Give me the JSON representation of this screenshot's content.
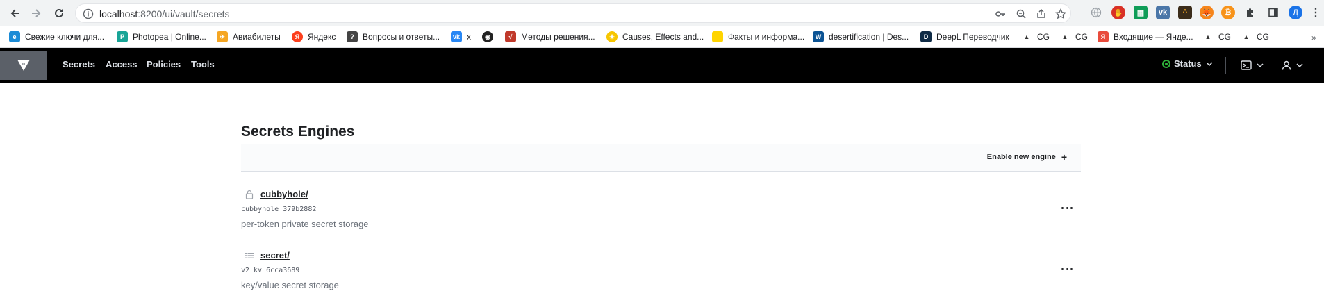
{
  "browser": {
    "url_host": "localhost",
    "url_rest": ":8200/ui/vault/secrets",
    "profile_initial": "Д",
    "bookmarks": [
      {
        "label": "Свежие ключи для...",
        "color": "#1b8bd6"
      },
      {
        "label": "Photopea | Online...",
        "color": "#18a497"
      },
      {
        "label": "Авиабилеты",
        "color": "#f5a623"
      },
      {
        "label": "Яндекс",
        "color": "#fc3f1d"
      },
      {
        "label": "Вопросы и ответы...",
        "color": "#444444"
      },
      {
        "label": "x",
        "color": "#2787f5"
      },
      {
        "label": "",
        "color": "#222222"
      },
      {
        "label": "Методы решения...",
        "color": "#c0392b"
      },
      {
        "label": "Causes, Effects and...",
        "color": "#f7c600"
      },
      {
        "label": "Факты и информа...",
        "color": "#ffd400"
      },
      {
        "label": "desertification | Des...",
        "color": "#0b5394"
      },
      {
        "label": "DeepL Переводчик",
        "color": "#0f2b46"
      },
      {
        "label": "CG",
        "color": "#333333"
      },
      {
        "label": "CG",
        "color": "#333333"
      },
      {
        "label": "Входящие — Янде...",
        "color": "#e94b3c"
      },
      {
        "label": "CG",
        "color": "#333333"
      },
      {
        "label": "CG",
        "color": "#333333"
      }
    ],
    "bookmarks_more": "»"
  },
  "vault_nav": {
    "links": [
      "Secrets",
      "Access",
      "Policies",
      "Tools"
    ],
    "status_label": "Status",
    "status_color": "#2eb039"
  },
  "page": {
    "title": "Secrets Engines",
    "enable_button_label": "Enable new engine",
    "enable_button_icon": "+"
  },
  "engines": [
    {
      "icon": "lock-icon",
      "path": "cubbyhole/",
      "accessor": "cubbyhole_379b2882",
      "description": "per-token private secret storage"
    },
    {
      "icon": "list-icon",
      "path": "secret/",
      "accessor": "v2 kv_6cca3689",
      "description": "key/value secret storage"
    }
  ]
}
